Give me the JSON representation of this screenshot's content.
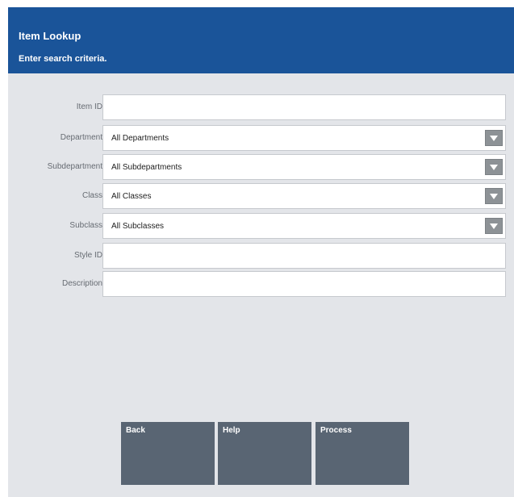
{
  "header": {
    "title": "Item Lookup",
    "subtitle": "Enter search criteria."
  },
  "form": {
    "item_id": {
      "label": "Item ID",
      "value": ""
    },
    "department": {
      "label": "Department",
      "value": "All Departments"
    },
    "subdepartment": {
      "label": "Subdepartment",
      "value": "All Subdepartments"
    },
    "class": {
      "label": "Class",
      "value": "All Classes"
    },
    "subclass": {
      "label": "Subclass",
      "value": "All Subclasses"
    },
    "style_id": {
      "label": "Style ID",
      "value": ""
    },
    "description": {
      "label": "Description",
      "value": ""
    }
  },
  "buttons": {
    "back": "Back",
    "help": "Help",
    "process": "Process"
  },
  "colors": {
    "header_bg": "#1a5499",
    "panel_bg": "#e3e5e9",
    "button_bg": "#596573"
  },
  "icons": {
    "dropdown": "chevron-down-icon"
  }
}
